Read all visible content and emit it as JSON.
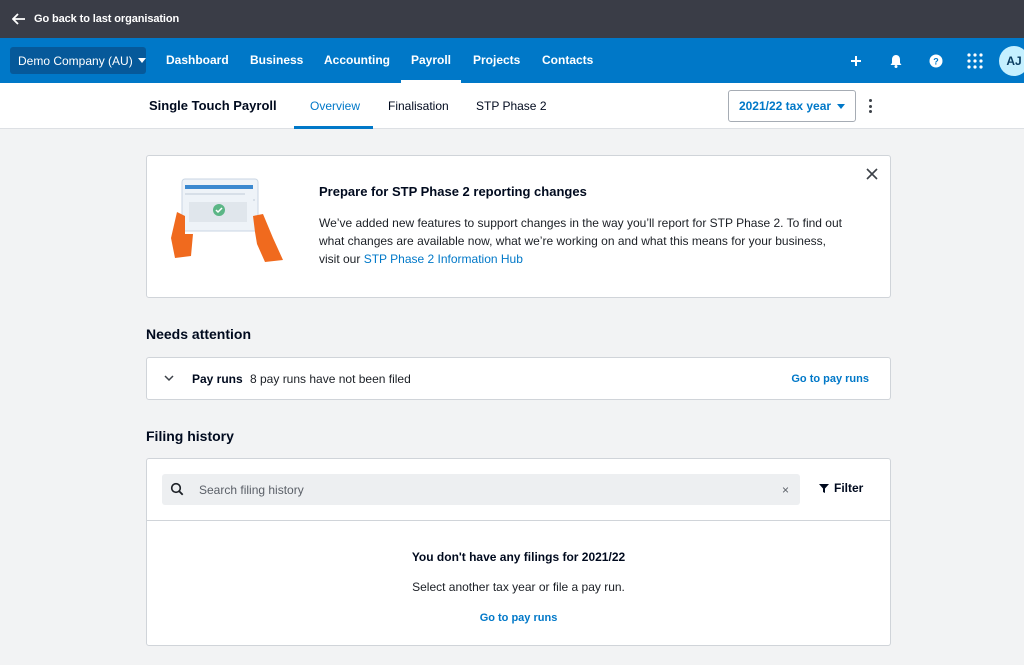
{
  "topbar": {
    "back_label": "Go back to last organisation"
  },
  "nav": {
    "org": "Demo Company (AU)",
    "items": [
      {
        "label": "Dashboard"
      },
      {
        "label": "Business"
      },
      {
        "label": "Accounting"
      },
      {
        "label": "Payroll",
        "active": true
      },
      {
        "label": "Projects"
      },
      {
        "label": "Contacts"
      }
    ],
    "icons": [
      "add-icon",
      "bell-icon",
      "help-icon",
      "apps-grid-icon"
    ],
    "avatar": "AJ"
  },
  "subheader": {
    "title": "Single Touch Payroll",
    "tabs": [
      {
        "label": "Overview",
        "active": true
      },
      {
        "label": "Finalisation"
      },
      {
        "label": "STP Phase 2"
      }
    ],
    "tax_year": "2021/22 tax year"
  },
  "banner": {
    "heading": "Prepare for STP Phase 2 reporting changes",
    "body": "We’ve added new features to support changes in the way you’ll report for STP Phase 2. To find out what changes are available now, what we’re working on and what this means for your business, visit our ",
    "link": "STP Phase 2 Information Hub"
  },
  "needs_attention": {
    "title": "Needs attention",
    "row_label": "Pay runs",
    "row_desc": "8 pay runs have not been filed",
    "row_link": "Go to pay runs"
  },
  "filing_history": {
    "title": "Filing history",
    "search_placeholder": "Search filing history",
    "clear": "×",
    "filter": "Filter",
    "empty_title": "You don't have any filings for 2021/22",
    "empty_desc": "Select another tax year or file a pay run.",
    "empty_link": "Go to pay runs"
  },
  "colors": {
    "nav_blue": "#0078c8",
    "topbar": "#3a3d47",
    "link": "#0078c8"
  }
}
